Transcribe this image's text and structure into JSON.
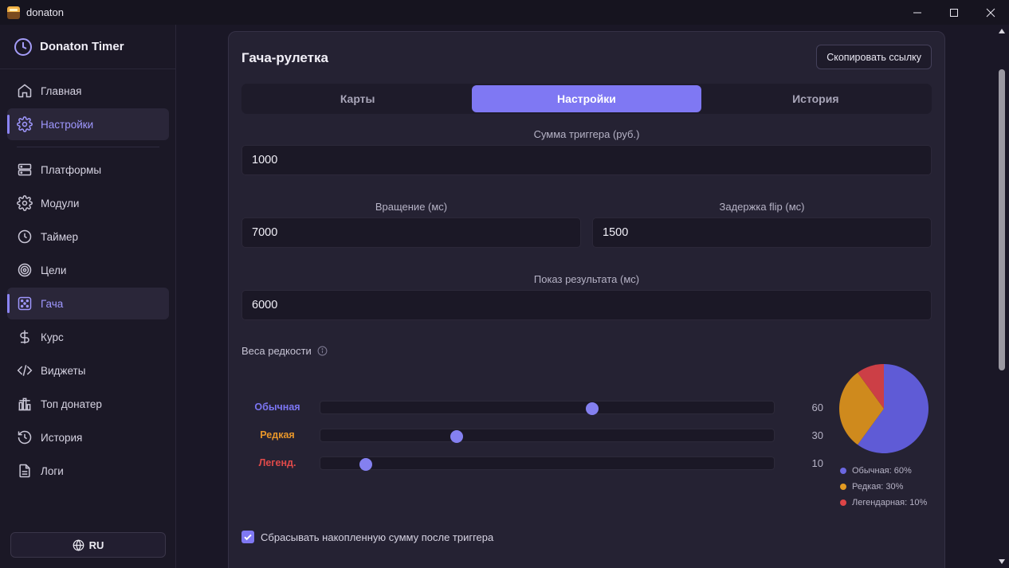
{
  "window": {
    "title": "donaton",
    "app_icon": "treasure-chest-icon"
  },
  "sidebar": {
    "brand": "Donaton Timer",
    "brand_icon": "clock-icon",
    "items": [
      {
        "label": "Главная",
        "icon": "home-icon"
      },
      {
        "label": "Настройки",
        "icon": "gear-icon"
      },
      {
        "label": "Платформы",
        "icon": "server-icon"
      },
      {
        "label": "Модули",
        "icon": "gear-icon"
      },
      {
        "label": "Таймер",
        "icon": "clock-icon"
      },
      {
        "label": "Цели",
        "icon": "target-icon"
      },
      {
        "label": "Гача",
        "icon": "dice-icon"
      },
      {
        "label": "Курс",
        "icon": "dollar-icon"
      },
      {
        "label": "Виджеты",
        "icon": "code-icon"
      },
      {
        "label": "Топ донатер",
        "icon": "podium-icon"
      },
      {
        "label": "История",
        "icon": "history-icon"
      },
      {
        "label": "Логи",
        "icon": "document-icon"
      }
    ],
    "language": "RU"
  },
  "card": {
    "title": "Гача-рулетка",
    "copy_button": "Скопировать ссылку",
    "tabs": [
      {
        "label": "Карты",
        "active": false
      },
      {
        "label": "Настройки",
        "active": true
      },
      {
        "label": "История",
        "active": false
      }
    ],
    "fields": {
      "trigger_sum": {
        "label": "Сумма триггера (руб.)",
        "value": "1000"
      },
      "spin": {
        "label": "Вращение (мс)",
        "value": "7000"
      },
      "flip_delay": {
        "label": "Задержка flip (мс)",
        "value": "1500"
      },
      "result_show": {
        "label": "Показ результата (мс)",
        "value": "6000"
      }
    },
    "weights": {
      "title": "Веса редкости",
      "rows": [
        {
          "label": "Обычная",
          "value": 60,
          "display": "60",
          "color": "#7b75f2"
        },
        {
          "label": "Редкая",
          "value": 30,
          "display": "30",
          "color": "#e8962a"
        },
        {
          "label": "Легенд.",
          "value": 10,
          "display": "10",
          "color": "#e04a4a"
        }
      ],
      "slider_max": 100
    },
    "chart_data": {
      "type": "pie",
      "categories": [
        "Обычная",
        "Редкая",
        "Легендарная"
      ],
      "values": [
        60,
        30,
        10
      ],
      "colors": [
        "#5f5bd6",
        "#cf8a1d",
        "#cc3f46"
      ],
      "legend": [
        "Обычная: 60%",
        "Редкая: 30%",
        "Легендарная: 10%"
      ],
      "legend_colors": [
        "#6b67e0",
        "#e39a22",
        "#dd4447"
      ]
    },
    "reset_checkbox": {
      "label": "Сбрасывать накопленную сумму после триггера",
      "checked": true
    }
  }
}
